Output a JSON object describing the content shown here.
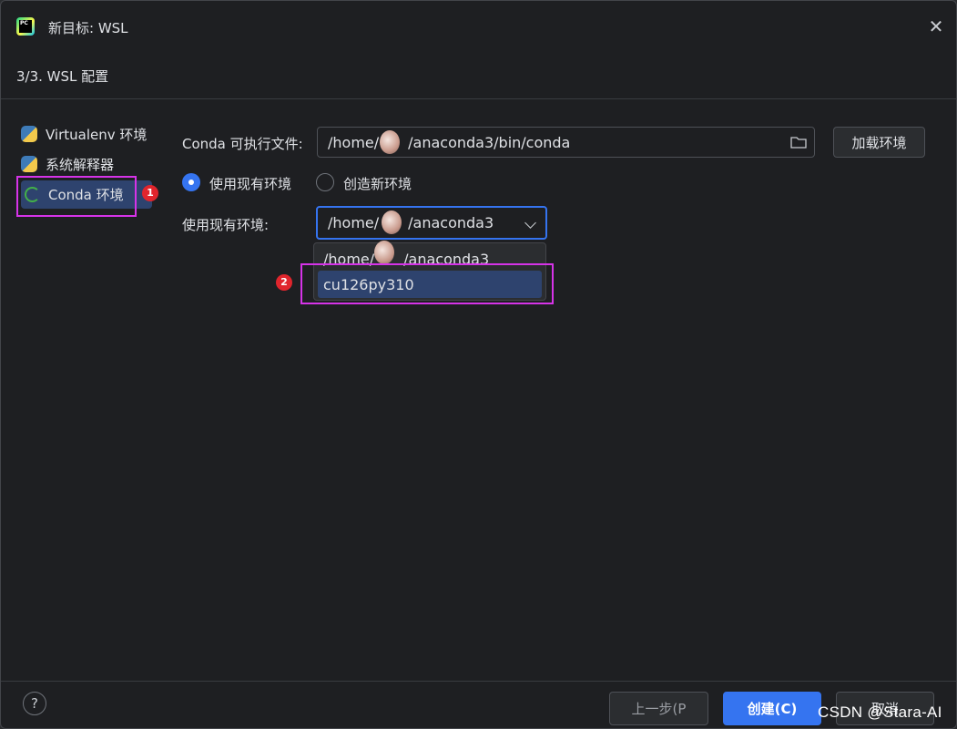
{
  "window": {
    "title": "新目标: WSL",
    "step": "3/3. WSL 配置",
    "app_icon_text": "PC"
  },
  "sidebar": {
    "items": [
      {
        "label": "Virtualenv 环境",
        "icon": "python-icon"
      },
      {
        "label": "系统解释器",
        "icon": "python-icon"
      },
      {
        "label": "Conda 环境",
        "icon": "conda-icon",
        "selected": true
      }
    ]
  },
  "annotations": {
    "badge1": "1",
    "badge2": "2",
    "highlight_color": "#d633e8"
  },
  "form": {
    "conda_exec_label": "Conda 可执行文件:",
    "conda_exec_prefix": "/home/",
    "conda_exec_suffix": "/anaconda3/bin/conda",
    "load_env_button": "加载环境",
    "radio_existing": "使用现有环境",
    "radio_new": "创造新环境",
    "existing_env_label": "使用现有环境:",
    "existing_env_prefix": "/home/",
    "existing_env_suffix": "/anaconda3",
    "dropdown_options": [
      {
        "prefix": "/home/",
        "suffix": "/anaconda3"
      },
      {
        "label": "cu126py310"
      }
    ]
  },
  "footer": {
    "help": "?",
    "prev_button": "上一步(P",
    "create_button": "创建(C)",
    "cancel_button": "取消"
  },
  "watermark": "CSDN @Stara-AI",
  "colors": {
    "accent": "#3574f0",
    "selection": "#2e436e",
    "background": "#1e1f22"
  }
}
